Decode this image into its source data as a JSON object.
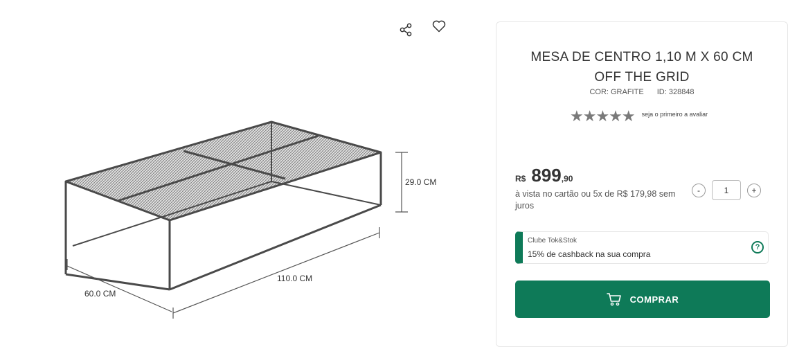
{
  "gallery": {
    "dimensions": {
      "height": "29.0 CM",
      "length": "110.0 CM",
      "depth": "60.0 CM"
    },
    "icons": [
      "share-icon",
      "heart-icon"
    ]
  },
  "product": {
    "title_line1": "MESA DE CENTRO 1,10 M X 60 CM",
    "title_line2": "OFF THE GRID",
    "color": "COR: GRAFITE",
    "id": "ID: 328848",
    "stars": "★★★★★",
    "rating_text": "seja o primeiro a avaliar"
  },
  "price": {
    "currency": "R$",
    "integer": "899",
    "cents": ",90",
    "installments": "à vista no cartão ou 5x de R$ 179,98 sem juros"
  },
  "quantity": {
    "minus": "-",
    "value": "1",
    "plus": "+"
  },
  "club": {
    "label": "Clube Tok&Stok",
    "description": "15% de cashback na sua compra",
    "help": "?"
  },
  "buy_button": {
    "label": "COMPRAR"
  },
  "colors": {
    "accent": "#0e7a58",
    "frame": "#4a4a4a"
  }
}
